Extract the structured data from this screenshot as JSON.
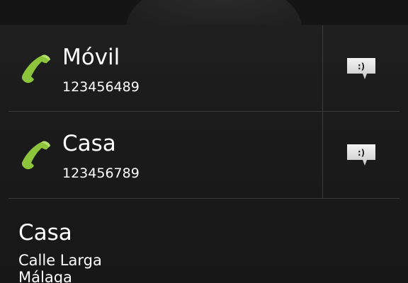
{
  "contact": {
    "phones": [
      {
        "type_label": "Móvil",
        "number": "123456489",
        "call_icon": "phone-handset-icon",
        "sms_icon": "sms-smiley-icon"
      },
      {
        "type_label": "Casa",
        "number": "123456789",
        "call_icon": "phone-handset-icon",
        "sms_icon": "sms-smiley-icon"
      }
    ],
    "address": {
      "type_label": "Casa",
      "street": "Calle Larga",
      "city": "Málaga"
    },
    "sms_glyph": ":)"
  },
  "colors": {
    "background": "#1a1a1a",
    "phone_icon": "#8cc43c",
    "divider": "#3a3a3a",
    "sms_bubble": "#e8e8e8"
  }
}
